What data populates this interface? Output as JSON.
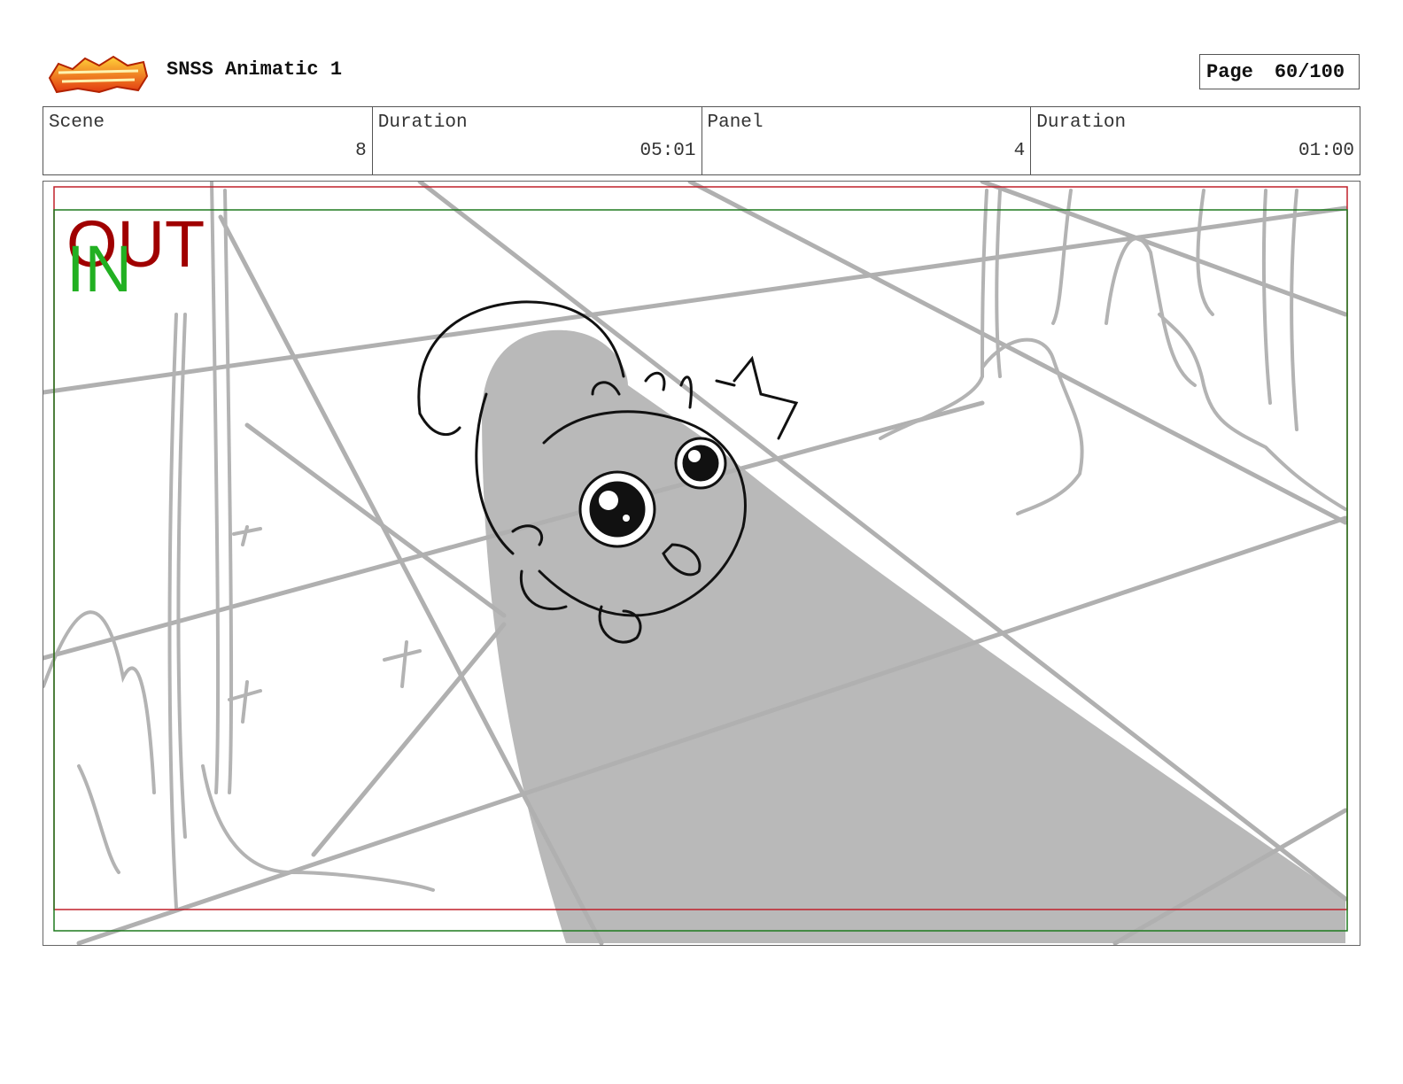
{
  "header": {
    "title": "SNSS Animatic 1",
    "page_label": "Page",
    "page_value": "60/100",
    "logo_icon": "show-logo-icon"
  },
  "info": {
    "scene_label": "Scene",
    "scene_value": "8",
    "scene_duration_label": "Duration",
    "scene_duration_value": "05:01",
    "panel_label": "Panel",
    "panel_value": "4",
    "panel_duration_label": "Duration",
    "panel_duration_value": "01:00"
  },
  "frame": {
    "out_label": "OUT",
    "in_label": "IN",
    "out_color": "#a00000",
    "in_color": "#22b022"
  }
}
